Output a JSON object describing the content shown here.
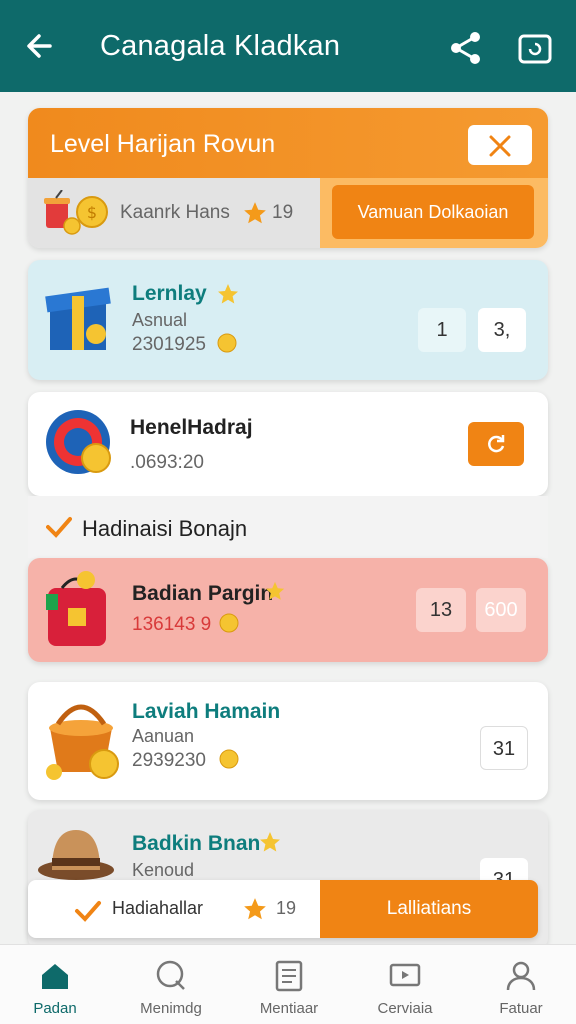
{
  "header": {
    "title": "Canagala Kladkan",
    "back_icon": "arrow-left-icon",
    "share_icon": "share-icon",
    "cast_icon": "cast-icon"
  },
  "banner": {
    "title": "Level Harijan Rovun",
    "close_icon": "close-icon",
    "sub_text": "Kaanrk Hans",
    "sub_number": "19",
    "claim_label": "Vamuan Dolkaoian"
  },
  "items": [
    {
      "title": "Lernlay",
      "subtitle": "Asnual",
      "value": "2301925",
      "pill1": "1",
      "pill2": "3,"
    },
    {
      "title": "HenelHadraj",
      "value": ".0693:20",
      "pill_icon": "refresh-icon"
    },
    {
      "section_label": "Hadinaisi Bonajn"
    },
    {
      "title": "Badian Pargin",
      "value": "136143 9",
      "pill1": "13",
      "pill2": "600"
    },
    {
      "title": "Laviah Hamain",
      "subtitle": "Aanuan",
      "value": "2939230",
      "pill1": "31"
    },
    {
      "title": "Badkin Bnan",
      "subtitle": "Kenoud",
      "pill1": "31"
    }
  ],
  "footer_bar": {
    "label": "Hadiahallar",
    "number": "19",
    "button": "Lalliatians"
  },
  "nav": [
    {
      "label": "Padan",
      "icon": "home-icon",
      "active": true
    },
    {
      "label": "Menimdg",
      "icon": "search-icon"
    },
    {
      "label": "Mentiaar",
      "icon": "document-icon"
    },
    {
      "label": "Cerviaia",
      "icon": "tv-icon"
    },
    {
      "label": "Fatuar",
      "icon": "profile-icon"
    }
  ],
  "colors": {
    "header": "#0e6a6a",
    "accent": "#f08414",
    "highlight_pink": "#f6b2a9",
    "highlight_blue": "#d8eef3"
  }
}
